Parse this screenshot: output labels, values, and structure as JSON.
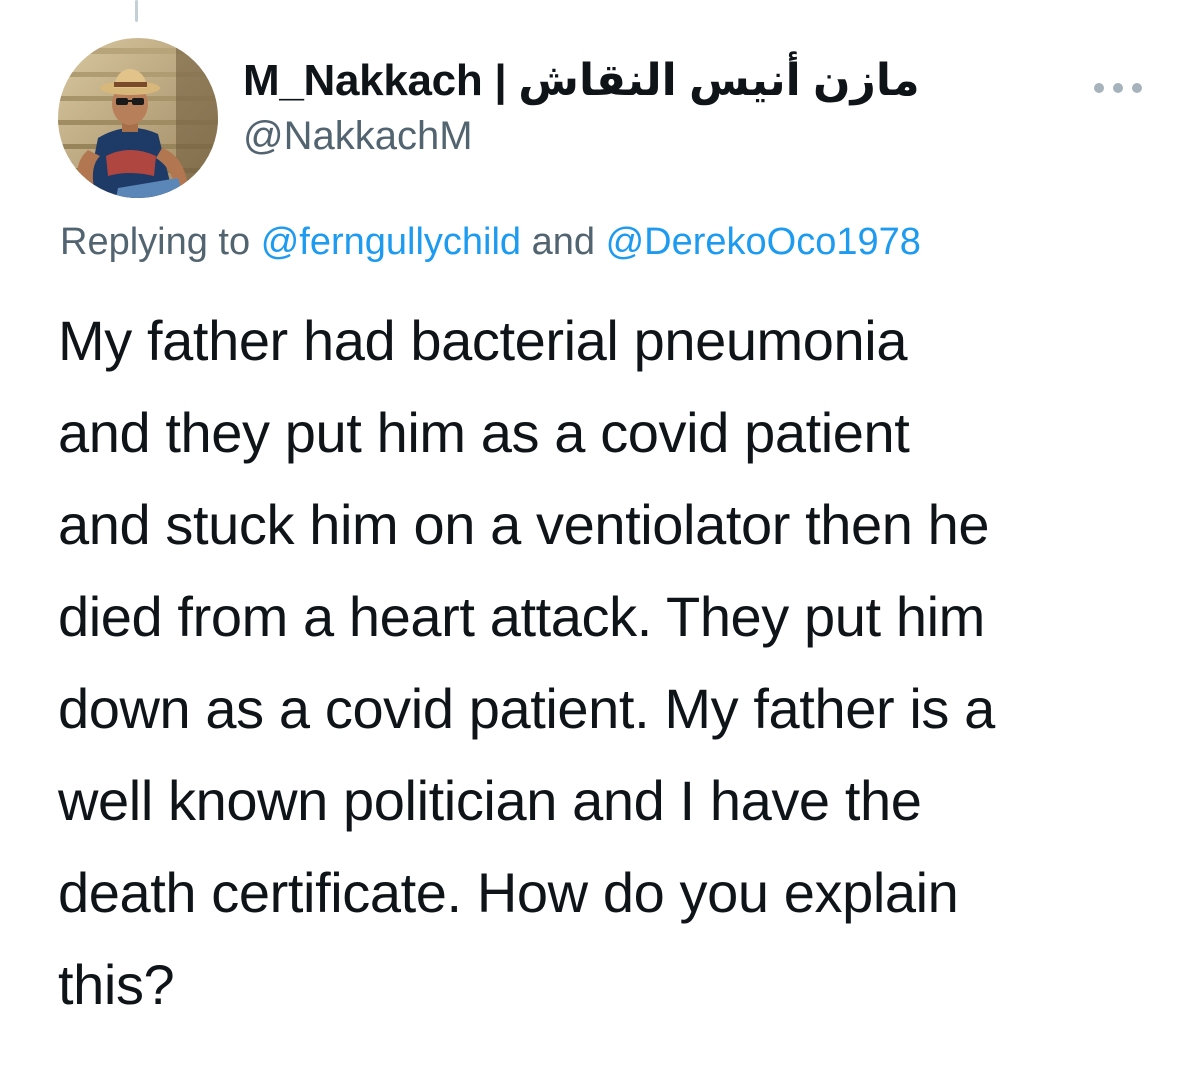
{
  "tweet": {
    "author": {
      "display_name": "M_Nakkach | مازن أنيس النقاش",
      "handle": "@NakkachM",
      "avatar_icon": "profile-photo"
    },
    "more_icon": "more-horizontal-icon",
    "reply": {
      "prefix": "Replying to",
      "mention_1": "@ferngullychild",
      "conjunction": "and",
      "mention_2": "@DerekoOco1978"
    },
    "body_lines": [
      "My father had bacterial pneumonia",
      "and they put him as a covid patient",
      "and stuck him on a ventiolator then he",
      "died from a heart attack. They put him",
      "down as a covid patient. My father is a",
      "well known politician and I have the",
      "death certificate. How do you explain",
      "this?"
    ]
  },
  "colors": {
    "text_primary": "#0f1419",
    "text_secondary": "#536471",
    "link": "#1d9bf0",
    "thread_line": "#c4cfd6"
  }
}
